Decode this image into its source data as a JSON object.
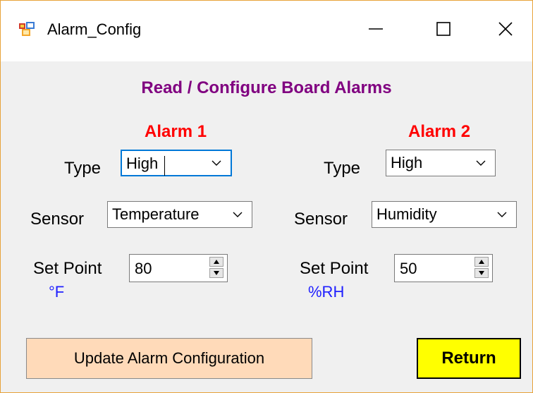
{
  "window": {
    "title": "Alarm_Config",
    "controls": {
      "minimize": "minimize",
      "maximize": "maximize",
      "close": "close"
    }
  },
  "heading": "Read / Configure Board Alarms",
  "alarm1": {
    "title": "Alarm 1",
    "type_label": "Type",
    "type_value": "High",
    "sensor_label": "Sensor",
    "sensor_value": "Temperature",
    "setpoint_label": "Set Point",
    "setpoint_value": "80",
    "unit": "°F"
  },
  "alarm2": {
    "title": "Alarm 2",
    "type_label": "Type",
    "type_value": "High",
    "sensor_label": "Sensor",
    "sensor_value": "Humidity",
    "setpoint_label": "Set Point",
    "setpoint_value": "50",
    "unit": "%RH"
  },
  "buttons": {
    "update": "Update Alarm Configuration",
    "return": "Return"
  },
  "colors": {
    "heading": "#800080",
    "alarm_title": "#ff0000",
    "unit": "#2020ff",
    "update_bg": "#ffdab9",
    "return_bg": "#ffff00",
    "window_border": "#e8a33a"
  },
  "icons": {
    "app": "app-window-icon",
    "dropdown": "chevron-down-icon",
    "spin_up": "spin-up-arrow-icon",
    "spin_down": "spin-down-arrow-icon"
  }
}
